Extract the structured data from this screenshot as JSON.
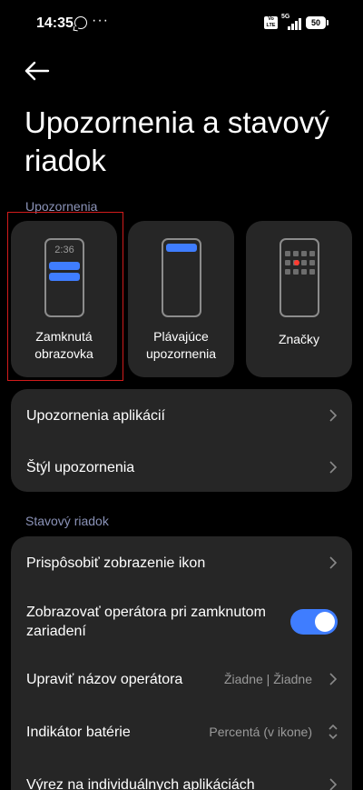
{
  "status_bar": {
    "time": "14:35",
    "more_indicator": "···",
    "volte_label": "Vo LTE",
    "network_label": "5G",
    "battery_level": "50",
    "icons": [
      "whatsapp-icon",
      "volte-icon",
      "signal-icon",
      "battery-icon"
    ]
  },
  "header": {
    "back_icon": "arrow-left-icon",
    "title": "Upozornenia a stavový riadok"
  },
  "notifications_section": {
    "label": "Upozornenia",
    "tiles": [
      {
        "label": "Zamknutá obrazovka",
        "preview_time": "2:36",
        "icon": "lockscreen-preview-icon",
        "selected": true
      },
      {
        "label": "Plávajúce upozornenia",
        "icon": "floating-notification-preview-icon",
        "selected": false
      },
      {
        "label": "Značky",
        "icon": "badges-preview-icon",
        "selected": false
      }
    ],
    "rows": [
      {
        "label": "Upozornenia aplikácií",
        "icon": "chevron-right-icon"
      },
      {
        "label": "Štýl upozornenia",
        "icon": "chevron-right-icon"
      }
    ]
  },
  "status_bar_section": {
    "label": "Stavový riadok",
    "rows": [
      {
        "label": "Prispôsobiť zobrazenie ikon",
        "icon": "chevron-right-icon"
      },
      {
        "label": "Zobrazovať operátora pri zamknutom zariadení",
        "toggle_on": true
      },
      {
        "label": "Upraviť názov operátora",
        "value": "Žiadne | Žiadne",
        "icon": "chevron-right-icon"
      },
      {
        "label": "Indikátor batérie",
        "value": "Percentá (v ikone)",
        "icon": "chevron-updown-icon"
      },
      {
        "label": "Výrez na individuálnych aplikáciách",
        "icon": "chevron-right-icon"
      }
    ]
  },
  "colors": {
    "background": "#000000",
    "card": "#262626",
    "accent": "#3f7dff",
    "section_label": "#8b93b8",
    "secondary_text": "#9a9a9a",
    "selection_frame": "#d11b1b"
  }
}
